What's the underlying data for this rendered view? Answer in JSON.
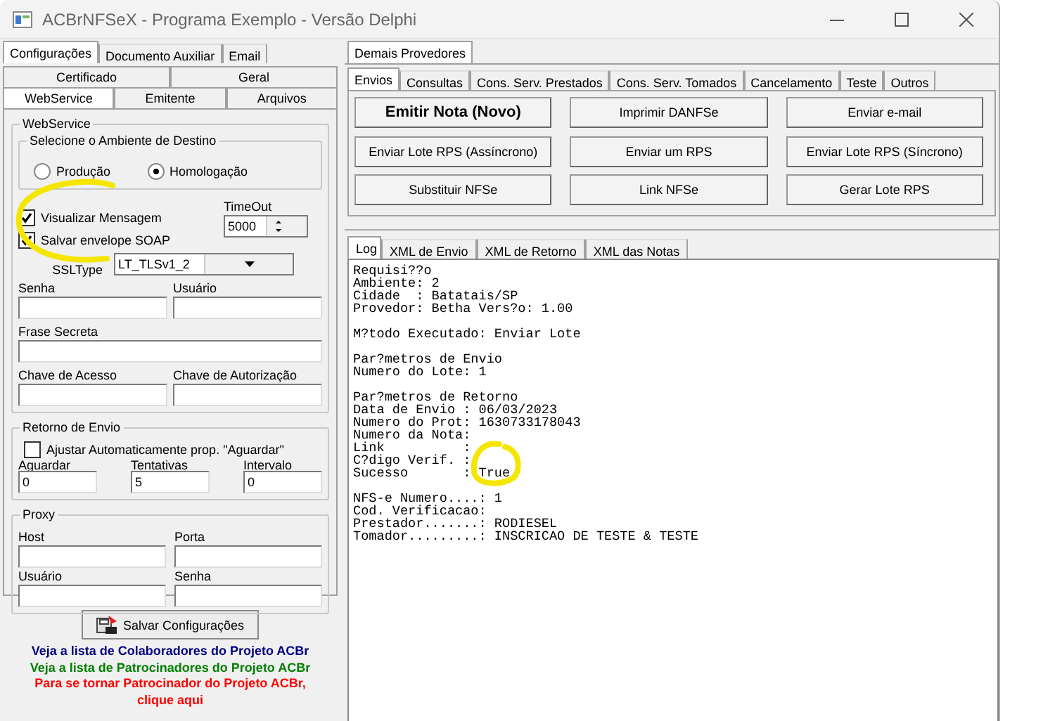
{
  "window": {
    "title": "ACBrNFSeX - Programa Exemplo - Versão Delphi"
  },
  "left_tabs": [
    {
      "label": "Configurações",
      "selected": true
    },
    {
      "label": "Documento Auxiliar",
      "selected": false
    },
    {
      "label": "Email",
      "selected": false
    }
  ],
  "config_tabs": {
    "back_row": [
      {
        "label": "Certificado",
        "selected": false
      },
      {
        "label": "Geral",
        "selected": false
      }
    ],
    "front_row": [
      {
        "label": "WebService",
        "selected": true
      },
      {
        "label": "Emitente",
        "selected": false
      },
      {
        "label": "Arquivos",
        "selected": false
      }
    ]
  },
  "webservice": {
    "title": "WebService",
    "ambiente": {
      "title": "Selecione o Ambiente de Destino",
      "options": [
        {
          "label": "Produção",
          "selected": false
        },
        {
          "label": "Homologação",
          "selected": true
        }
      ]
    },
    "checkboxes": [
      {
        "label": "Visualizar Mensagem",
        "checked": true
      },
      {
        "label": "Salvar envelope SOAP",
        "checked": true
      }
    ],
    "timeout": {
      "label": "TimeOut",
      "value": "5000"
    },
    "ssl_type": {
      "label": "SSLType",
      "value": "LT_TLSv1_2"
    },
    "field_rows": [
      [
        {
          "label": "Senha"
        },
        {
          "label": "Usuário"
        }
      ],
      [
        {
          "label": "Frase Secreta"
        }
      ],
      [
        {
          "label": "Chave de Acesso"
        },
        {
          "label": "Chave de Autorização"
        }
      ]
    ]
  },
  "retorno": {
    "title": "Retorno de Envio",
    "checkbox": {
      "label": "Ajustar Automaticamente prop. \"Aguardar\"",
      "checked": false
    },
    "fields": [
      {
        "label": "Aguardar",
        "value": "0"
      },
      {
        "label": "Tentativas",
        "value": "5"
      },
      {
        "label": "Intervalo",
        "value": "0"
      }
    ]
  },
  "proxy": {
    "title": "Proxy",
    "field_rows": [
      [
        {
          "label": "Host"
        },
        {
          "label": "Porta"
        }
      ],
      [
        {
          "label": "Usuário"
        },
        {
          "label": "Senha"
        }
      ]
    ]
  },
  "save_button": "Salvar Configurações",
  "links": [
    {
      "text": "Veja a lista de Colaboradores do Projeto ACBr",
      "color": "#000080"
    },
    {
      "text": "Veja a lista de Patrocinadores do Projeto ACBr",
      "color": "#008000"
    },
    {
      "text": "Para se tornar Patrocinador do Projeto ACBr, clique aqui",
      "color": "#ff0000"
    }
  ],
  "provider_tabs": [
    {
      "label": "Demais Provedores",
      "selected": true
    }
  ],
  "action_tabs": [
    {
      "label": "Envios",
      "selected": true
    },
    {
      "label": "Consultas",
      "selected": false
    },
    {
      "label": "Cons. Serv. Prestados",
      "selected": false
    },
    {
      "label": "Cons. Serv. Tomados",
      "selected": false
    },
    {
      "label": "Cancelamento",
      "selected": false
    },
    {
      "label": "Teste",
      "selected": false
    },
    {
      "label": "Outros",
      "selected": false
    }
  ],
  "action_buttons": [
    {
      "label": "Emitir Nota (Novo)",
      "kind": "primary"
    },
    {
      "label": "Imprimir DANFSe",
      "kind": "normal"
    },
    {
      "label": "Enviar e-mail",
      "kind": "normal"
    },
    {
      "label": "Enviar Lote RPS (Assíncrono)",
      "kind": "normal"
    },
    {
      "label": "Enviar um RPS",
      "kind": "normal"
    },
    {
      "label": "Enviar Lote RPS (Síncrono)",
      "kind": "normal"
    },
    {
      "label": "Substituir NFSe",
      "kind": "normal"
    },
    {
      "label": "Link NFSe",
      "kind": "normal"
    },
    {
      "label": "Gerar Lote RPS",
      "kind": "normal"
    }
  ],
  "log_tabs": [
    {
      "label": "Log",
      "selected": true
    },
    {
      "label": "XML de Envio",
      "selected": false
    },
    {
      "label": "XML de Retorno",
      "selected": false
    },
    {
      "label": "XML das Notas",
      "selected": false
    }
  ],
  "log": [
    [
      "Requisi??o",
      "Ambiente: 2",
      "Cidade  : Batatais/SP",
      "Provedor: Betha Vers?o: 1.00"
    ],
    [
      "M?todo Executado: Enviar Lote"
    ],
    [
      "Par?metros de Envio",
      "Numero do Lote: 1"
    ],
    [
      "Par?metros de Retorno",
      "Data de Envio : 06/03/2023",
      "Numero do Prot: 1630733178043",
      "Numero da Nota:",
      "Link          :",
      "C?digo Verif. :",
      "Sucesso       : True"
    ],
    [
      "NFS-e Numero....: 1",
      "Cod. Verificacao:",
      "Prestador.......: RODIESEL",
      "Tomador.........: INSCRICAO DE TESTE & TESTE"
    ]
  ]
}
